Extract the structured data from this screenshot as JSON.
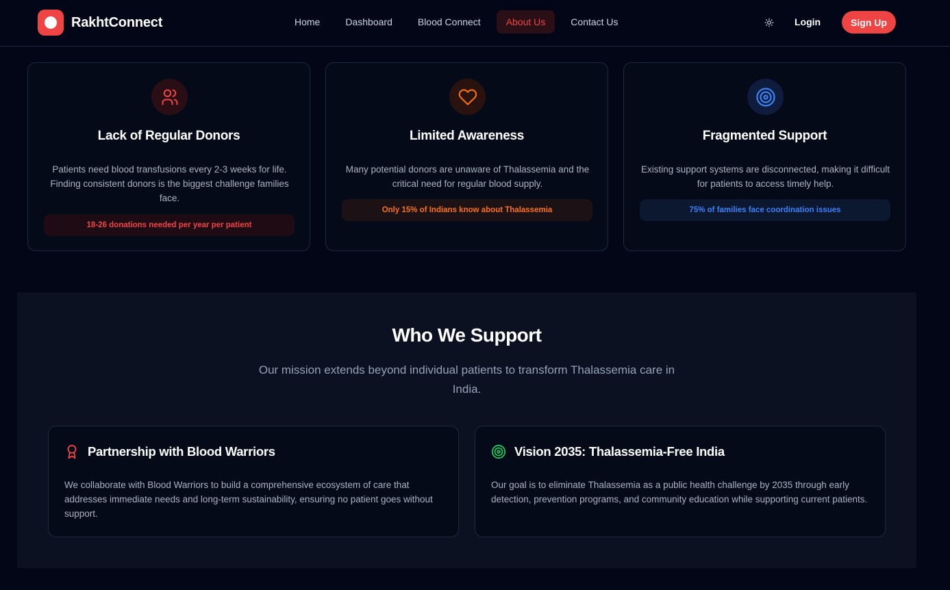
{
  "brand": {
    "name": "RakhtConnect"
  },
  "nav": {
    "items": [
      {
        "label": "Home"
      },
      {
        "label": "Dashboard"
      },
      {
        "label": "Blood Connect"
      },
      {
        "label": "About Us"
      },
      {
        "label": "Contact Us"
      }
    ],
    "active": "About Us"
  },
  "auth": {
    "login_label": "Login",
    "signup_label": "Sign Up"
  },
  "challenges": [
    {
      "icon": "users-icon",
      "title": "Lack of Regular Donors",
      "description": "Patients need blood transfusions every 2-3 weeks for life. Finding consistent donors is the biggest challenge families face.",
      "stat": "18-26 donations needed per year per patient",
      "accent": "#ef4444"
    },
    {
      "icon": "heart-icon",
      "title": "Limited Awareness",
      "description": "Many potential donors are unaware of Thalassemia and the critical need for regular blood supply.",
      "stat": "Only 15% of Indians know about Thalassemia",
      "accent": "#f97316"
    },
    {
      "icon": "target-icon",
      "title": "Fragmented Support",
      "description": "Existing support systems are disconnected, making it difficult for patients to access timely help.",
      "stat": "75% of families face coordination issues",
      "accent": "#3b82f6"
    }
  ],
  "support": {
    "title": "Who We Support",
    "subtitle": "Our mission extends beyond individual patients to transform Thalassemia care in India.",
    "cards": [
      {
        "icon": "award-icon",
        "title": "Partnership with Blood Warriors",
        "description": "We collaborate with Blood Warriors to build a comprehensive ecosystem of care that addresses immediate needs and long-term sustainability, ensuring no patient goes without support.",
        "accent": "#ef4444"
      },
      {
        "icon": "target-icon",
        "title": "Vision 2035: Thalassemia-Free India",
        "description": "Our goal is to eliminate Thalassemia as a public health challenge by 2035 through early detection, prevention programs, and community education while supporting current patients.",
        "accent": "#22c55e"
      }
    ]
  }
}
